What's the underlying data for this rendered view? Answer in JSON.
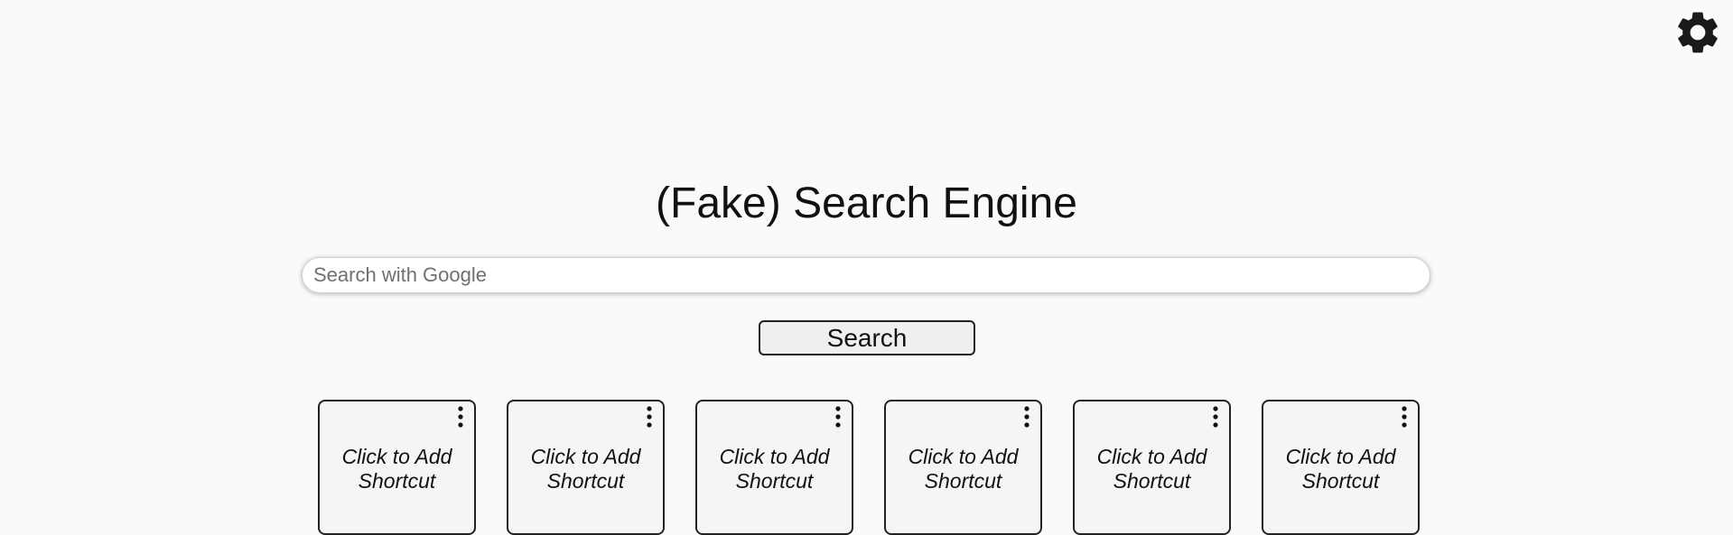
{
  "header": {
    "settings_icon": "gear-icon"
  },
  "main": {
    "title": "(Fake) Search Engine",
    "search": {
      "placeholder": "Search with Google",
      "value": ""
    },
    "search_button_label": "Search"
  },
  "shortcuts": [
    {
      "label": "Click to Add Shortcut",
      "menu_icon": "kebab-menu-icon"
    },
    {
      "label": "Click to Add Shortcut",
      "menu_icon": "kebab-menu-icon"
    },
    {
      "label": "Click to Add Shortcut",
      "menu_icon": "kebab-menu-icon"
    },
    {
      "label": "Click to Add Shortcut",
      "menu_icon": "kebab-menu-icon"
    },
    {
      "label": "Click to Add Shortcut",
      "menu_icon": "kebab-menu-icon"
    },
    {
      "label": "Click to Add Shortcut",
      "menu_icon": "kebab-menu-icon"
    }
  ],
  "colors": {
    "background": "#fafafa",
    "text": "#111111",
    "tile_background": "#f5f5f5",
    "button_background": "#efefef"
  }
}
